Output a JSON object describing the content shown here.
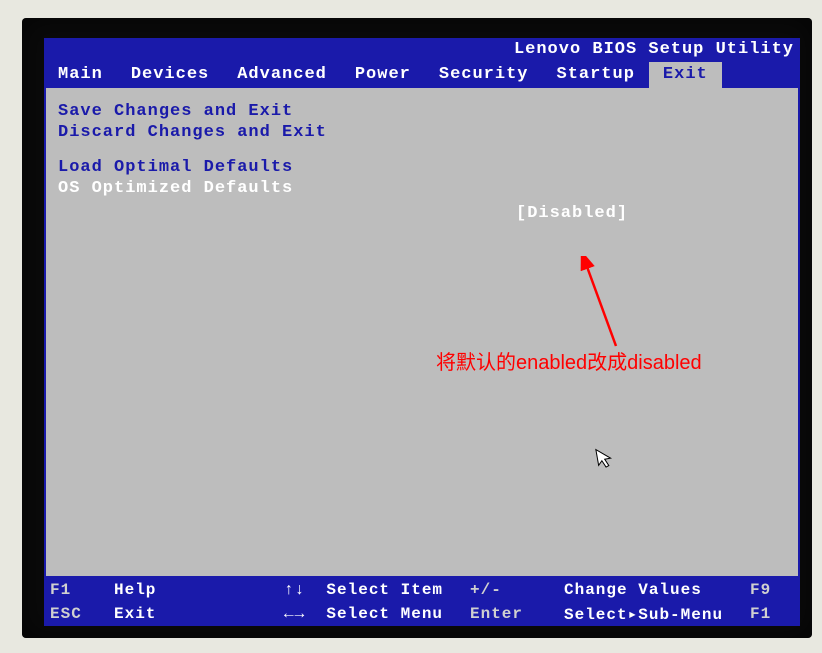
{
  "title": "Lenovo BIOS Setup Utility",
  "menu": {
    "items": [
      "Main",
      "Devices",
      "Advanced",
      "Power",
      "Security",
      "Startup",
      "Exit"
    ],
    "active": "Exit"
  },
  "options": {
    "save_exit": "Save Changes and Exit",
    "discard_exit": "Discard Changes and Exit",
    "load_defaults": "Load Optimal Defaults",
    "os_optimized": "OS Optimized Defaults",
    "os_optimized_value": "[Disabled]"
  },
  "annotation": "将默认的enabled改成disabled",
  "footer": {
    "r1c1": "F1",
    "r1c2": "Help",
    "r1c3": "Select Item",
    "r1c4": "+/-",
    "r1c5": "Change Values",
    "r1c6": "F9",
    "r2c1": "ESC",
    "r2c2": "Exit",
    "r2c3": "Select Menu",
    "r2c4": "Enter",
    "r2c5": "Select▸Sub-Menu",
    "r2c6": "F1"
  },
  "nav_symbols": {
    "updown": "↑↓",
    "leftright": "←→"
  }
}
